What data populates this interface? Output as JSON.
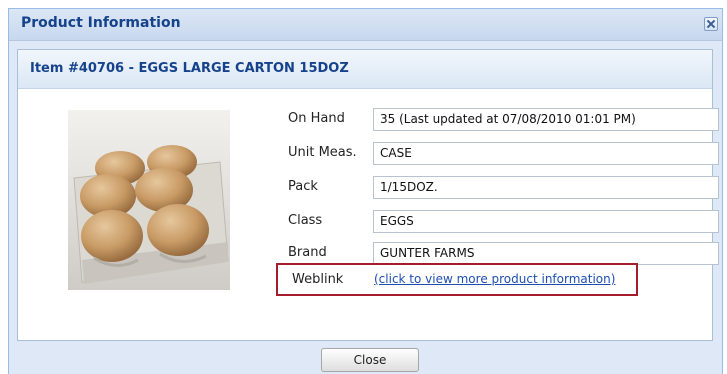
{
  "dialog": {
    "title": "Product Information",
    "close_icon": "close-icon"
  },
  "item": {
    "header": "Item #40706 - EGGS LARGE CARTON 15DOZ",
    "image": "eggs-in-carton-photo"
  },
  "fields": [
    {
      "label": "On Hand",
      "value": "35  (Last updated at 07/08/2010 01:01 PM)"
    },
    {
      "label": "Unit Meas.",
      "value": "CASE"
    },
    {
      "label": "Pack",
      "value": "1/15DOZ."
    },
    {
      "label": "Class",
      "value": "EGGS"
    },
    {
      "label": "Brand",
      "value": "GUNTER FARMS"
    }
  ],
  "weblink": {
    "label": "Weblink",
    "link_text": "(click to view more product information)"
  },
  "footer": {
    "close_label": "Close"
  },
  "colors": {
    "title_text": "#15428b",
    "dialog_bg": "#dfe8f6",
    "highlight_border": "#a51d2d",
    "link": "#1d4fb0"
  }
}
